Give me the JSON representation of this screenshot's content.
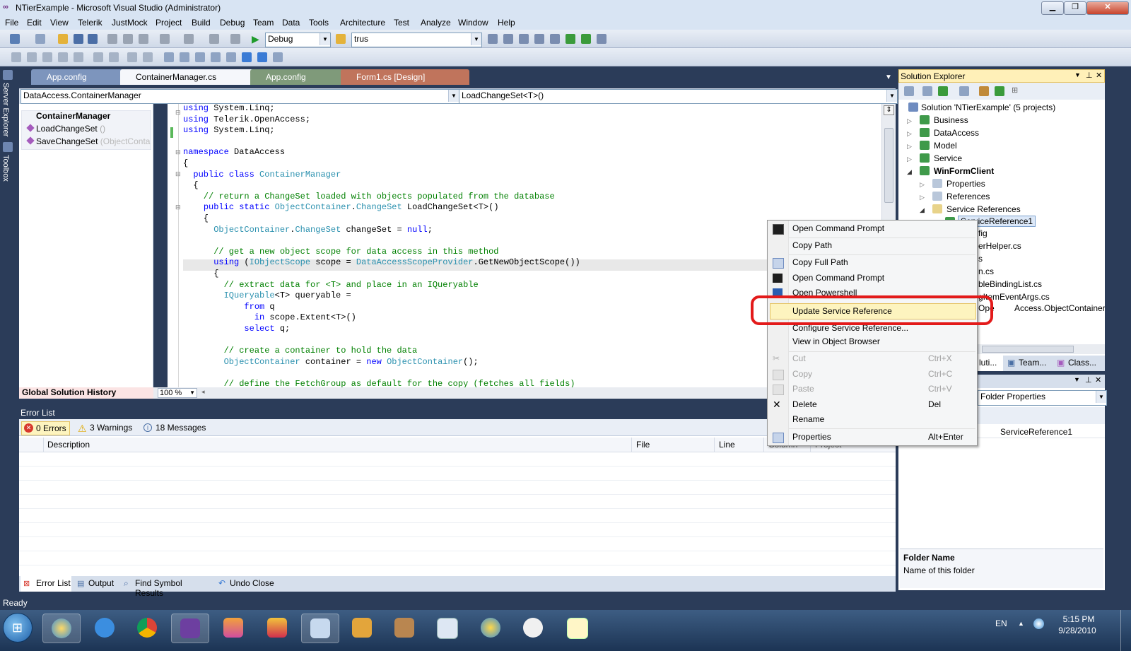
{
  "window": {
    "title": "NTierExample - Microsoft Visual Studio (Administrator)",
    "min_glyph": "▁",
    "max_glyph": "❐",
    "close_glyph": "✕"
  },
  "menu": [
    "File",
    "Edit",
    "View",
    "Telerik",
    "JustMock",
    "Project",
    "Build",
    "Debug",
    "Team",
    "Data",
    "Tools",
    "Architecture",
    "Test",
    "Analyze",
    "Window",
    "Help"
  ],
  "toolbar": {
    "config_combo": "Debug",
    "find_combo": "trus"
  },
  "left_strip": {
    "server_explorer": "Server Explorer",
    "toolbox": "Toolbox"
  },
  "tabs": [
    {
      "label": "App.config"
    },
    {
      "label": "ContainerManager.cs"
    },
    {
      "label": "App.config"
    },
    {
      "label": "Form1.cs [Design]"
    }
  ],
  "tab_close": "x",
  "navbar": {
    "type_combo": "DataAccess.ContainerManager",
    "member_combo": "LoadChangeSet<T>()"
  },
  "outline": {
    "class_name": "ContainerManager",
    "items": [
      {
        "name": "LoadChangeSet",
        "hint": "()"
      },
      {
        "name": "SaveChangeSet",
        "hint": "(ObjectContain"
      }
    ],
    "history_label": "Global Solution History"
  },
  "zoom": "100 %",
  "code_lines": [
    "using System.Linq;",
    "using Telerik.OpenAccess;",
    "using System.Linq;",
    "",
    "namespace DataAccess",
    "{",
    "  public class ContainerManager",
    "  {",
    "    // return a ChangeSet loaded with objects populated from the database",
    "    public static ObjectContainer.ChangeSet LoadChangeSet<T>()",
    "    {",
    "      ObjectContainer.ChangeSet changeSet = null;",
    "",
    "      // get a new object scope for data access in this method",
    "      using (IObjectScope scope = DataAccessScopeProvider.GetNewObjectScope())",
    "      {",
    "        // extract data for <T> and place in an IQueryable",
    "        IQueryable<T> queryable =",
    "            from q",
    "              in scope.Extent<T>()",
    "            select q;",
    "",
    "        // create a container to hold the data",
    "        ObjectContainer container = new ObjectContainer();",
    "",
    "        // define the FetchGroup as default for the copy (fetches all fields)"
  ],
  "error_list": {
    "title": "Error List",
    "errors": "0 Errors",
    "warnings": "3 Warnings",
    "messages": "18 Messages",
    "columns": [
      "Description",
      "File",
      "Line",
      "Column",
      "Project"
    ]
  },
  "bottom_tabs": [
    "Error List",
    "Output",
    "Find Symbol Results",
    "Undo Close"
  ],
  "status": "Ready",
  "solution_explorer": {
    "title": "Solution Explorer",
    "solution": "Solution 'NTierExample' (5 projects)",
    "projects": [
      "Business",
      "DataAccess",
      "Model",
      "Service",
      "WinFormClient"
    ],
    "winform_children": [
      "Properties",
      "References",
      "Service References"
    ],
    "selected": "ServiceReference1",
    "partial_items": [
      "fig",
      "erHelper.cs",
      "s",
      "n.cs",
      "bleBindingList.cs",
      "gItemEventArgs.cs",
      "Ope",
      "Access.ObjectContainer.datas"
    ],
    "bottom_tabs": [
      "luti...",
      "Team...",
      "Class..."
    ]
  },
  "properties": {
    "combo": "Folder Properties",
    "value": "ServiceReference1",
    "desc_title": "Folder Name",
    "desc_text": "Name of this folder"
  },
  "context_menu": {
    "items": [
      {
        "label": "Open Command Prompt",
        "shortcut": "",
        "disabled": false
      },
      {
        "label": "Copy Path",
        "shortcut": "",
        "disabled": false
      },
      {
        "label": "Copy Full Path",
        "shortcut": "",
        "disabled": false
      },
      {
        "label": "Open Command Prompt",
        "shortcut": "",
        "disabled": false
      },
      {
        "label": "Open Powershell",
        "shortcut": "",
        "disabled": false
      },
      {
        "label": "Update Service Reference",
        "shortcut": "",
        "disabled": false
      },
      {
        "label": "Configure Service Reference...",
        "shortcut": "",
        "disabled": false
      },
      {
        "label": "View in Object Browser",
        "shortcut": "",
        "disabled": false
      },
      {
        "label": "Cut",
        "shortcut": "Ctrl+X",
        "disabled": true
      },
      {
        "label": "Copy",
        "shortcut": "Ctrl+C",
        "disabled": true
      },
      {
        "label": "Paste",
        "shortcut": "Ctrl+V",
        "disabled": true
      },
      {
        "label": "Delete",
        "shortcut": "Del",
        "disabled": false
      },
      {
        "label": "Rename",
        "shortcut": "",
        "disabled": false
      },
      {
        "label": "Properties",
        "shortcut": "Alt+Enter",
        "disabled": false
      }
    ]
  },
  "taskbar": {
    "lang": "EN",
    "time": "5:15 PM",
    "date": "9/28/2010"
  },
  "colors": {
    "accent": "#2b3c59",
    "highlight_ring": "#e31a1a",
    "menu_hover": "#fdf4bf"
  }
}
